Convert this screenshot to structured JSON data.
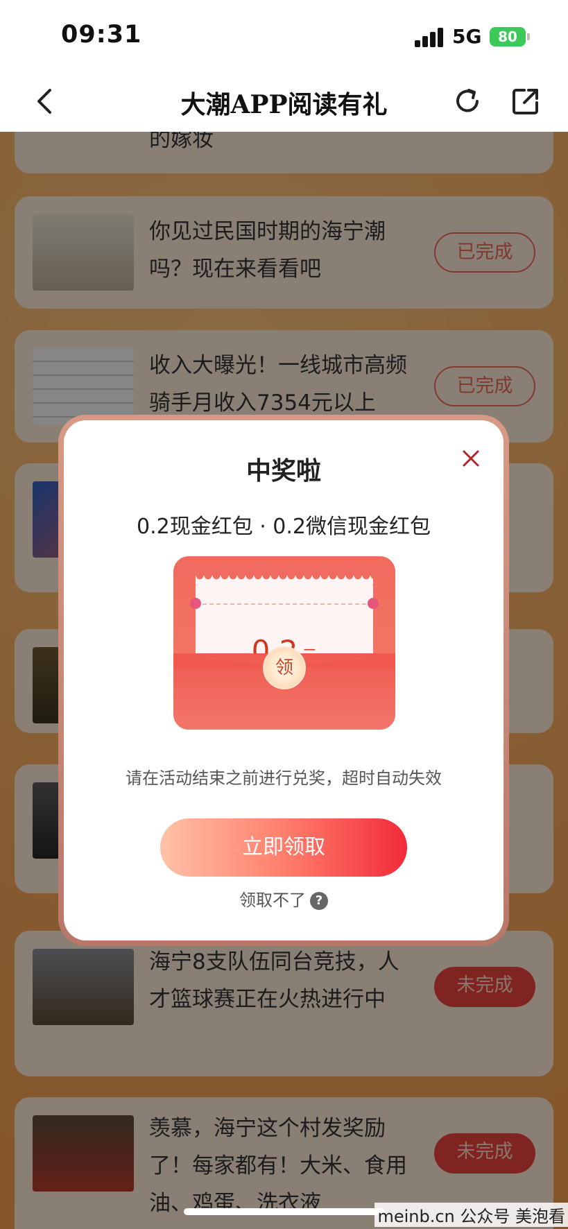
{
  "status_bar": {
    "time": "09:31",
    "network": "5G",
    "battery": "80"
  },
  "nav": {
    "title": "大潮APP阅读有礼",
    "back_icon": "chevron-left-icon",
    "refresh_icon": "refresh-icon",
    "share_icon": "share-icon"
  },
  "articles": [
    {
      "title": "的嫁妆",
      "status": ""
    },
    {
      "title": "你见过民国时期的海宁潮吗？现在来看看吧",
      "status": "已完成"
    },
    {
      "title": "收入大曝光！一线城市高频骑手月收入7354元以上",
      "status": "已完成"
    },
    {
      "title": "海宁8支队伍同台竞技，人才篮球赛正在火热进行中",
      "status": "未完成"
    },
    {
      "title": "羡慕，海宁这个村发奖励了！每家都有！大米、食用油、鸡蛋、洗衣液",
      "status": "未完成"
    }
  ],
  "modal": {
    "title": "中奖啦",
    "prize_label": "0.2现金红包 · 0.2微信现金红包",
    "amount": "0.2",
    "unit": "元",
    "seal_text": "领",
    "notice": "请在活动结束之前进行兑奖，超时自动失效",
    "claim_button": "立即领取",
    "help_text": "领取不了",
    "help_icon_glyph": "?"
  },
  "watermark": "meinb.cn 公众号 美泡看",
  "colors": {
    "accent_red": "#f22b3a",
    "done_outline": "#e66b56",
    "todo_fill": "#e8433c",
    "battery_green": "#3bc95a"
  }
}
